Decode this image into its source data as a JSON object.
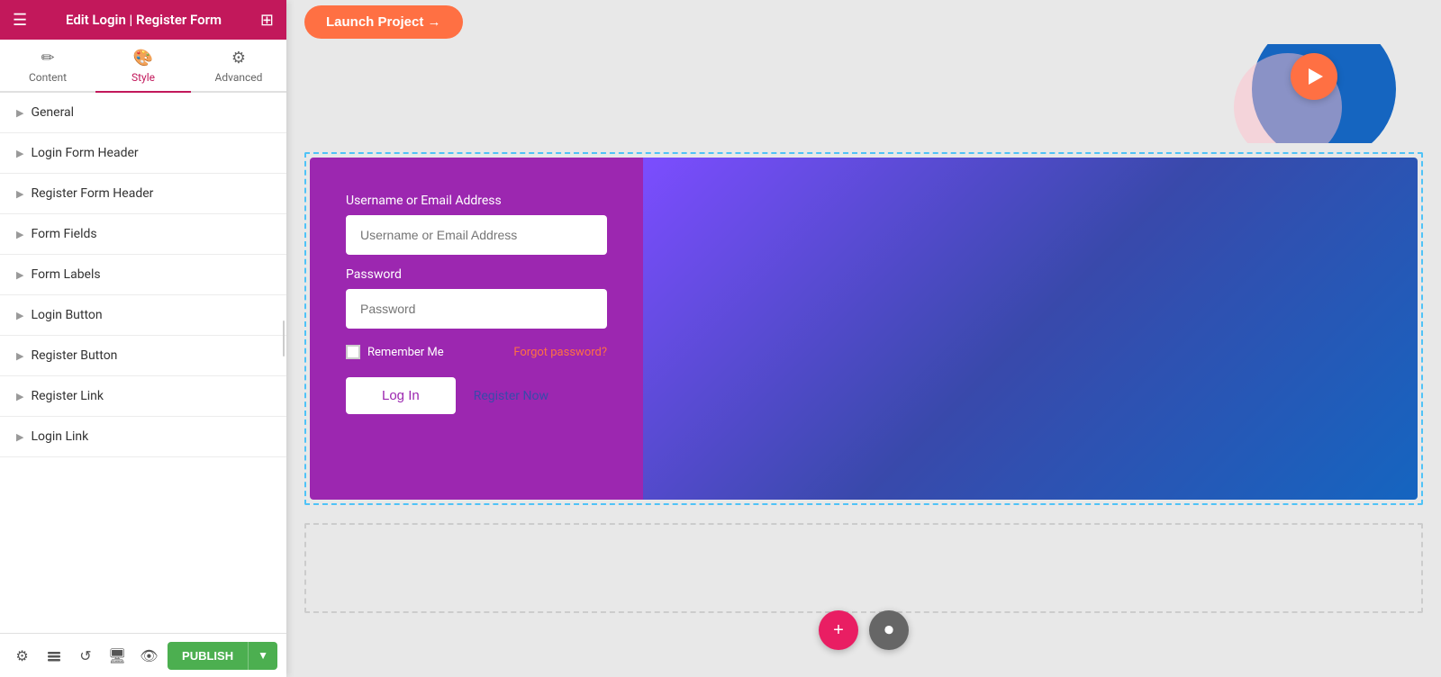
{
  "topbar": {
    "title": "Edit Login | Register Form",
    "menu_icon": "☰",
    "grid_icon": "⊞"
  },
  "tabs": [
    {
      "id": "content",
      "label": "Content",
      "icon": "✏️",
      "active": false
    },
    {
      "id": "style",
      "label": "Style",
      "icon": "🎨",
      "active": true
    },
    {
      "id": "advanced",
      "label": "Advanced",
      "icon": "⚙️",
      "active": false
    }
  ],
  "sections": [
    {
      "id": "general",
      "label": "General"
    },
    {
      "id": "login-form-header",
      "label": "Login Form Header"
    },
    {
      "id": "register-form-header",
      "label": "Register Form Header"
    },
    {
      "id": "form-fields",
      "label": "Form Fields"
    },
    {
      "id": "form-labels",
      "label": "Form Labels"
    },
    {
      "id": "login-button",
      "label": "Login Button"
    },
    {
      "id": "register-button",
      "label": "Register Button"
    },
    {
      "id": "register-link",
      "label": "Register Link"
    },
    {
      "id": "login-link",
      "label": "Login Link"
    }
  ],
  "bottom_tools": [
    {
      "id": "settings",
      "icon": "⚙",
      "label": "settings-icon"
    },
    {
      "id": "layers",
      "icon": "◫",
      "label": "layers-icon"
    },
    {
      "id": "history",
      "icon": "↺",
      "label": "history-icon"
    },
    {
      "id": "responsive",
      "icon": "🖥",
      "label": "responsive-icon"
    },
    {
      "id": "eye",
      "icon": "👁",
      "label": "preview-icon"
    }
  ],
  "publish_label": "PUBLISH",
  "launch_label": "Launch Project →",
  "form": {
    "username_label": "Username or Email Address",
    "username_placeholder": "Username or Email Address",
    "password_label": "Password",
    "password_placeholder": "Password",
    "remember_label": "Remember Me",
    "forgot_label": "Forgot password?",
    "login_label": "Log In",
    "register_label": "Register Now"
  },
  "fab": {
    "add_icon": "+",
    "record_icon": "⏺"
  }
}
